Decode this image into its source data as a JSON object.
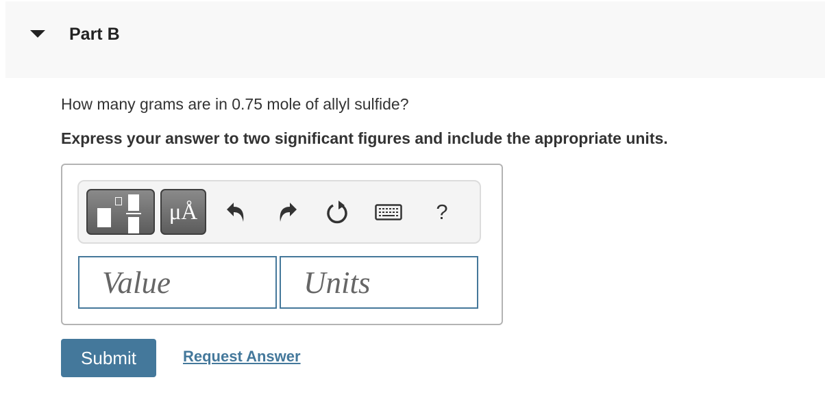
{
  "part": {
    "title": "Part B",
    "expanded": true
  },
  "question": {
    "text": "How many grams are in 0.75 mole of allyl sulfide?",
    "instruction": "Express your answer to two significant figures and include the appropriate units."
  },
  "toolbar": {
    "buttons": [
      {
        "name": "templates",
        "icon": "templates-icon"
      },
      {
        "name": "units",
        "label": "μÅ",
        "icon": "units-icon"
      },
      {
        "name": "undo",
        "icon": "undo-icon"
      },
      {
        "name": "redo",
        "icon": "redo-icon"
      },
      {
        "name": "reset",
        "icon": "reset-icon"
      },
      {
        "name": "keyboard",
        "icon": "keyboard-icon"
      },
      {
        "name": "help",
        "label": "?",
        "icon": "help-icon"
      }
    ]
  },
  "inputs": {
    "value": {
      "placeholder": "Value",
      "value": ""
    },
    "units": {
      "placeholder": "Units",
      "value": ""
    }
  },
  "actions": {
    "submit_label": "Submit",
    "request_answer_label": "Request Answer"
  },
  "colors": {
    "accent": "#44789b",
    "header_bg": "#f8f8f8"
  }
}
